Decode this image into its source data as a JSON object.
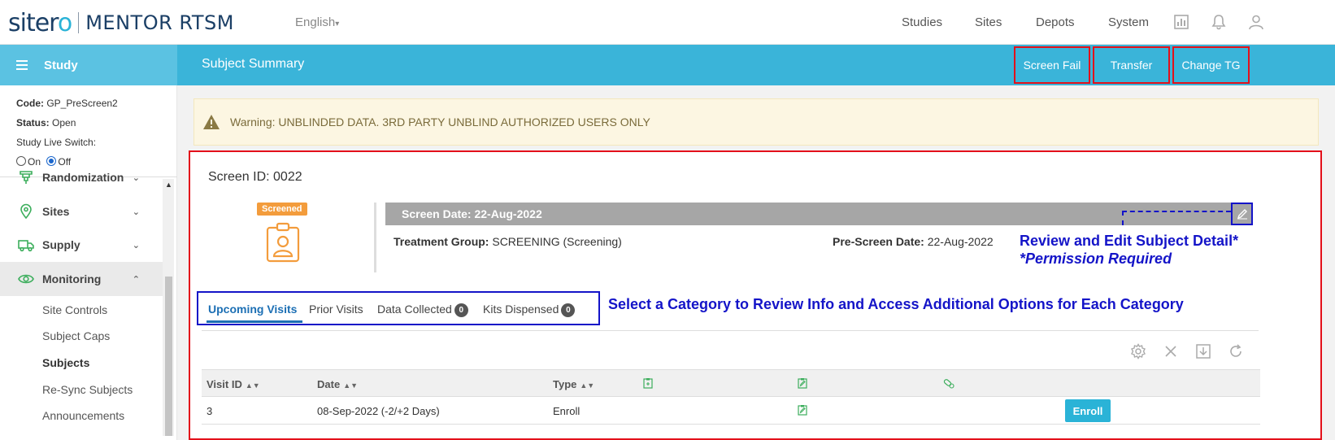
{
  "brand": {
    "name_part1": "siter",
    "name_part2": "o",
    "product": "MENTOR RTSM"
  },
  "language": {
    "selected": "English"
  },
  "topnav": [
    "Studies",
    "Sites",
    "Depots",
    "System"
  ],
  "sidebar": {
    "title": "Study",
    "info": {
      "code_label": "Code:",
      "code_value": "GP_PreScreen2",
      "status_label": "Status:",
      "status_value": "Open",
      "switch_label": "Study Live Switch:",
      "on_label": "On",
      "off_label": "Off",
      "switch_selected": "Off"
    },
    "menu": [
      {
        "label": "Randomization",
        "expanded": false
      },
      {
        "label": "Sites",
        "expanded": false
      },
      {
        "label": "Supply",
        "expanded": false
      },
      {
        "label": "Monitoring",
        "expanded": true
      }
    ],
    "submenu": [
      "Site Controls",
      "Subject Caps",
      "Subjects",
      "Re-Sync Subjects",
      "Announcements"
    ],
    "active_submenu": "Subjects"
  },
  "header": {
    "page_title": "Subject Summary",
    "buttons": [
      "Screen Fail",
      "Transfer",
      "Change TG"
    ]
  },
  "warning": {
    "text": "Warning: UNBLINDED DATA. 3RD PARTY UNBLIND AUTHORIZED USERS ONLY"
  },
  "subject": {
    "screen_id": "Screen ID: 0022",
    "status_badge": "Screened",
    "screen_date": "Screen Date: 22-Aug-2022",
    "treatment_group_label": "Treatment Group:",
    "treatment_group_value": "SCREENING (Screening)",
    "prescreen_label": "Pre-Screen Date:",
    "prescreen_value": "22-Aug-2022"
  },
  "annotations": {
    "edit_line1": "Review and Edit Subject Detail*",
    "edit_line2": "*Permission Required",
    "category": "Select a Category to Review Info and Access Additional Options for Each Category"
  },
  "tabs": [
    {
      "label": "Upcoming Visits",
      "active": true
    },
    {
      "label": "Prior Visits"
    },
    {
      "label": "Data Collected",
      "count": "0"
    },
    {
      "label": "Kits Dispensed",
      "count": "0"
    }
  ],
  "table": {
    "columns": [
      "Visit ID",
      "Date",
      "Type"
    ],
    "rows": [
      {
        "visit_id": "3",
        "date": "08-Sep-2022 (-2/+2 Days)",
        "type": "Enroll",
        "action": "Enroll"
      }
    ]
  },
  "colors": {
    "accent": "#3ab4d9",
    "annotation": "#1414c8",
    "highlight": "#e3101a",
    "badge": "#f39c3c"
  }
}
